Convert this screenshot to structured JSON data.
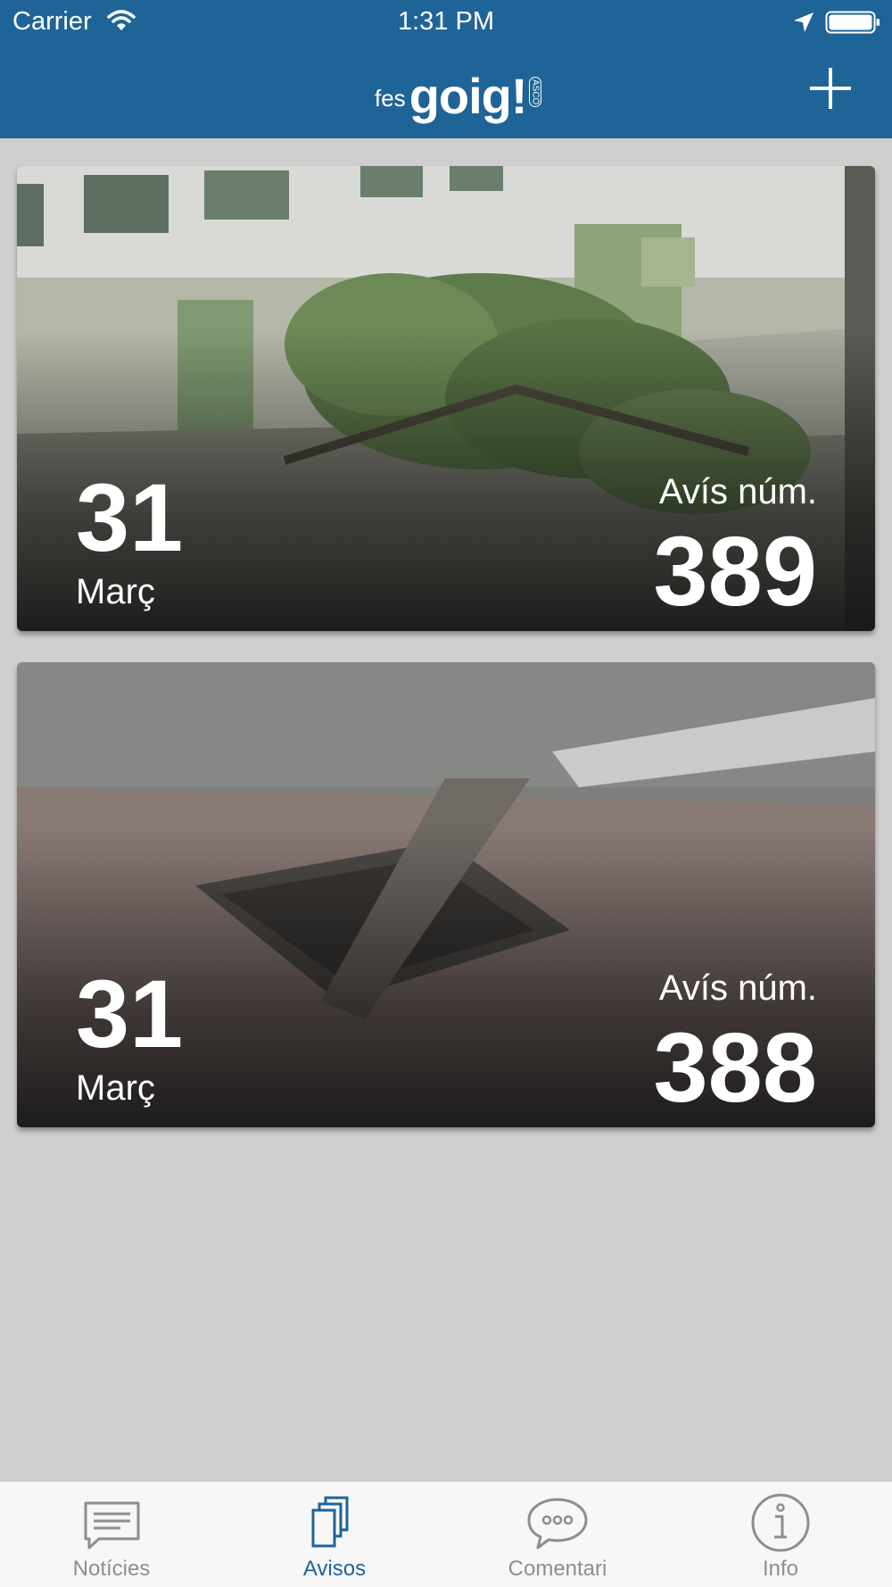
{
  "status_bar": {
    "carrier": "Carrier",
    "time": "1:31 PM"
  },
  "header": {
    "logo_small": "fes",
    "logo_big": "goig!",
    "logo_mark": "ASCO"
  },
  "cards": [
    {
      "day": "31",
      "month": "Març",
      "label": "Avís núm.",
      "number": "389",
      "photo": "fallen-tree"
    },
    {
      "day": "31",
      "month": "Març",
      "label": "Avís núm.",
      "number": "388",
      "photo": "broken-drain-cover"
    }
  ],
  "tabs": [
    {
      "label": "Notícies",
      "icon": "news-icon",
      "active": false
    },
    {
      "label": "Avisos",
      "icon": "notices-icon",
      "active": true
    },
    {
      "label": "Comentari",
      "icon": "comment-icon",
      "active": false
    },
    {
      "label": "Info",
      "icon": "info-icon",
      "active": false
    }
  ],
  "colors": {
    "brand_blue": "#1f6496",
    "background": "#cfcfcf",
    "tab_inactive": "#8e8e8e"
  }
}
